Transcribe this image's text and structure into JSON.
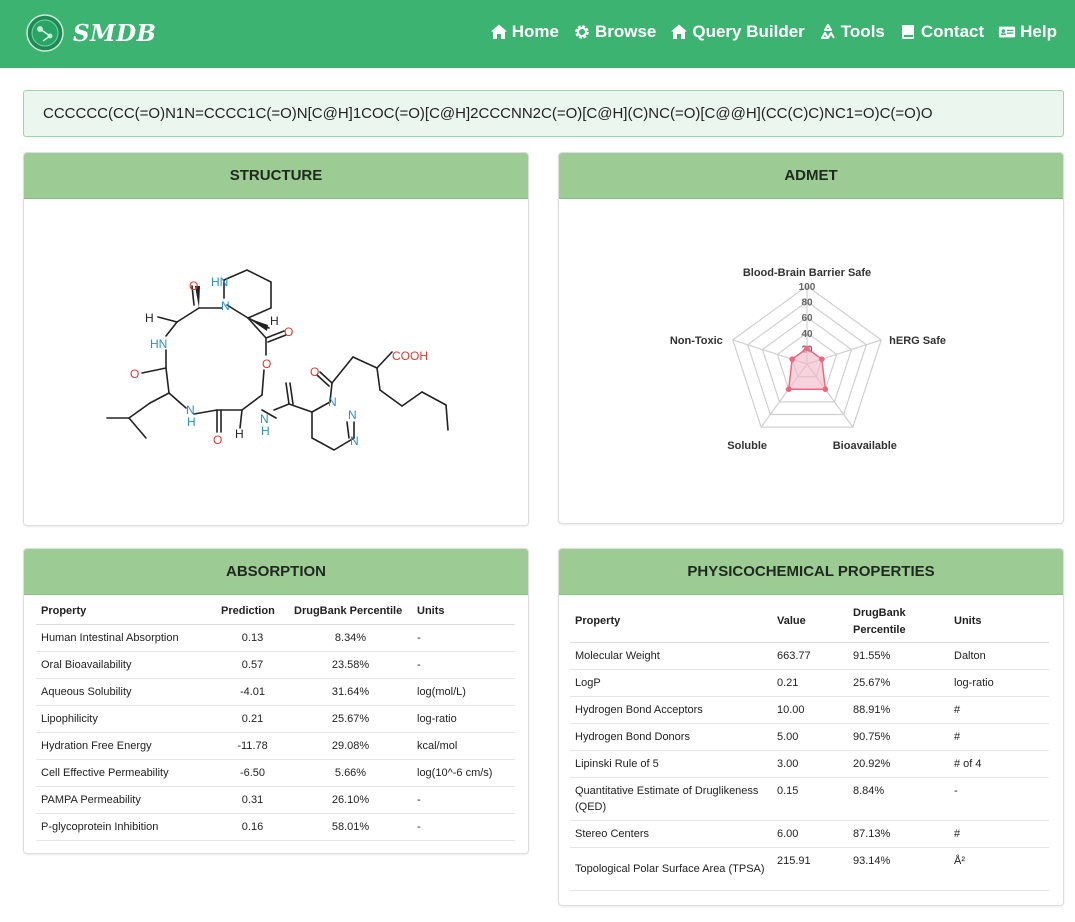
{
  "brand": {
    "name": "SMDB"
  },
  "nav": [
    {
      "label": "Home",
      "icon": "home-icon"
    },
    {
      "label": "Browse",
      "icon": "gear-icon"
    },
    {
      "label": "Query Builder",
      "icon": "home-icon"
    },
    {
      "label": "Tools",
      "icon": "recycle-icon"
    },
    {
      "label": "Contact",
      "icon": "book-icon"
    },
    {
      "label": "Help",
      "icon": "id-card-icon"
    }
  ],
  "smiles": "CCCCCC(CC(=O)N1N=CCCC1C(=O)N[C@H]1COC(=O)[C@H]2CCCNN2C(=O)[C@H](C)NC(=O)[C@@H](CC(C)C)NC1=O)C(=O)O",
  "structure": {
    "title": "STRUCTURE",
    "atoms": [
      "HN",
      "N",
      "H",
      "O",
      "HN",
      "O",
      "O",
      "H",
      "N",
      "H",
      "O",
      "H",
      "N",
      "H",
      "O",
      "N",
      "N",
      "N",
      "O",
      "COOH"
    ]
  },
  "admet": {
    "title": "ADMET",
    "axes": [
      "Blood-Brain Barrier Safe",
      "hERG Safe",
      "Bioavailable",
      "Soluble",
      "Non-Toxic"
    ],
    "ticks": [
      "100",
      "80",
      "60",
      "40",
      "20"
    ],
    "colors": {
      "fill": "#f2b8c6",
      "line": "#f0667f",
      "grid": "#d0d0d0"
    }
  },
  "chart_data": {
    "type": "radar",
    "categories": [
      "Blood-Brain Barrier Safe",
      "hERG Safe",
      "Bioavailable",
      "Soluble",
      "Non-Toxic"
    ],
    "values": [
      20,
      20,
      40,
      40,
      20
    ],
    "range": [
      0,
      100
    ]
  },
  "absorption": {
    "title": "ABSORPTION",
    "headers": [
      "Property",
      "Prediction",
      "DrugBank Percentile",
      "Units"
    ],
    "rows": [
      [
        "Human Intestinal Absorption",
        "0.13",
        "8.34%",
        "-"
      ],
      [
        "Oral Bioavailability",
        "0.57",
        "23.58%",
        "-"
      ],
      [
        "Aqueous Solubility",
        "-4.01",
        "31.64%",
        "log(mol/L)"
      ],
      [
        "Lipophilicity",
        "0.21",
        "25.67%",
        "log-ratio"
      ],
      [
        "Hydration Free Energy",
        "-11.78",
        "29.08%",
        "kcal/mol"
      ],
      [
        "Cell Effective Permeability",
        "-6.50",
        "5.66%",
        "log(10^-6 cm/s)"
      ],
      [
        "PAMPA Permeability",
        "0.31",
        "26.10%",
        "-"
      ],
      [
        "P-glycoprotein Inhibition",
        "0.16",
        "58.01%",
        "-"
      ]
    ]
  },
  "physico": {
    "title": "PHYSICOCHEMICAL PROPERTIES",
    "headers": [
      "Property",
      "Value",
      "DrugBank Percentile",
      "Units"
    ],
    "rows": [
      [
        "Molecular Weight",
        "663.77",
        "91.55%",
        "Dalton"
      ],
      [
        "LogP",
        "0.21",
        "25.67%",
        "log-ratio"
      ],
      [
        "Hydrogen Bond Acceptors",
        "10.00",
        "88.91%",
        "#"
      ],
      [
        "Hydrogen Bond Donors",
        "5.00",
        "90.75%",
        "#"
      ],
      [
        "Lipinski Rule of 5",
        "3.00",
        "20.92%",
        "# of 4"
      ],
      [
        "Quantitative Estimate of Druglikeness (QED)",
        "0.15",
        "8.84%",
        "-"
      ],
      [
        "Stereo Centers",
        "6.00",
        "87.13%",
        "#"
      ],
      [
        "Topological Polar Surface Area (TPSA)",
        "215.91",
        "93.14%",
        "Å²"
      ]
    ]
  }
}
